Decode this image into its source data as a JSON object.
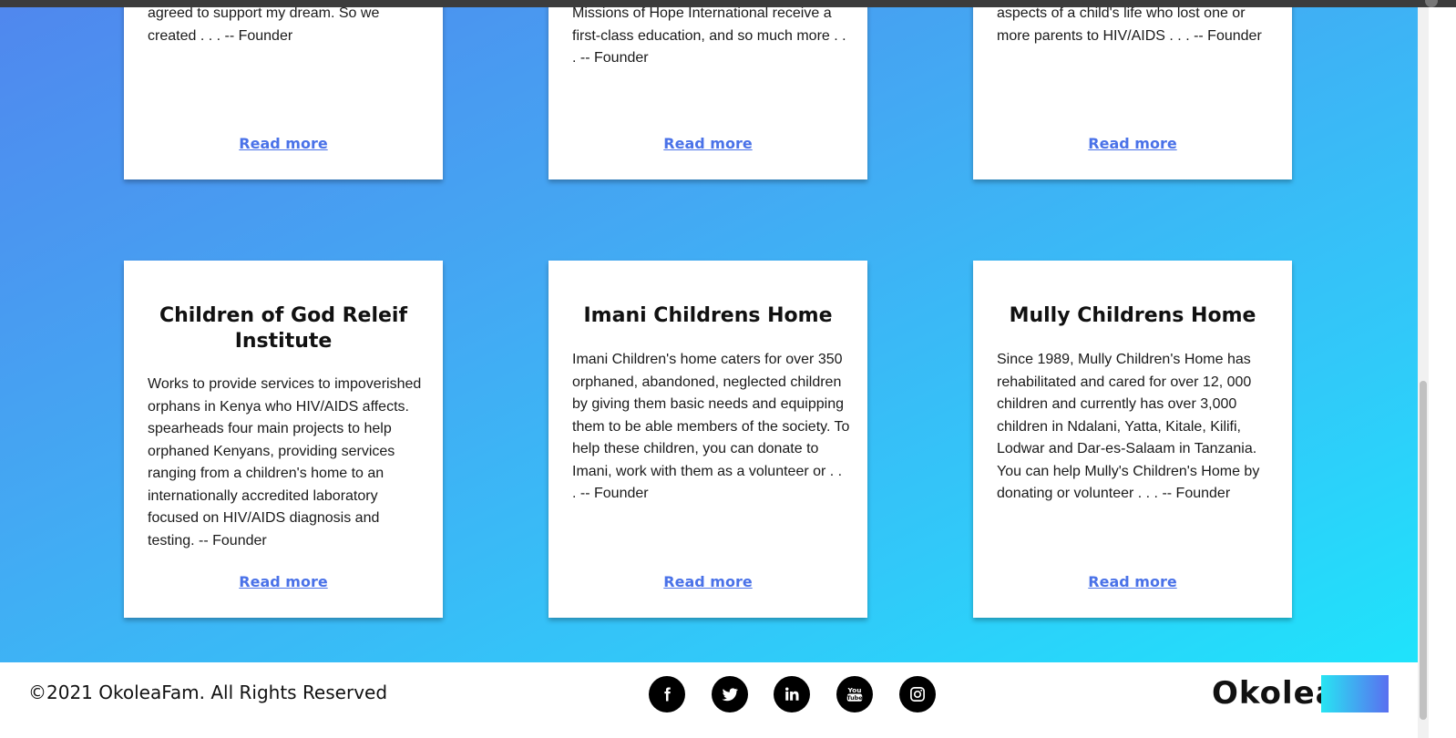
{
  "cards_top": [
    {
      "text_lines": [
        "agreed to support my dream. So we",
        "created . . . -- Founder"
      ],
      "link": "Read more"
    },
    {
      "text_lines": [
        "Missions of Hope International receive a",
        "first-class education, and so much more . .",
        ". -- Founder"
      ],
      "link": "Read more"
    },
    {
      "text_lines": [
        "aspects of a child's life who lost one or",
        "more parents to HIV/AIDS . . . -- Founder"
      ],
      "link": "Read more"
    }
  ],
  "cards_bottom": [
    {
      "title_lines": [
        "Children of God Releif",
        "Institute"
      ],
      "text_lines": [
        "Works to provide services to impoverished",
        "orphans in Kenya who HIV/AIDS affects.",
        "spearheads four main projects to help",
        "orphaned Kenyans, providing services",
        "ranging from a children's home to an",
        "internationally accredited laboratory",
        "focused on HIV/AIDS diagnosis and",
        "testing. -- Founder"
      ],
      "link": "Read more"
    },
    {
      "title_lines": [
        "Imani Childrens Home"
      ],
      "text_lines": [
        "Imani Children's home caters for over 350",
        "orphaned, abandoned, neglected children",
        "by giving them basic needs and equipping",
        "them to be able members of the society. To",
        "help these children, you can donate to",
        "Imani, work with them as a volunteer or . .",
        ". -- Founder"
      ],
      "link": "Read more"
    },
    {
      "title_lines": [
        "Mully Childrens Home"
      ],
      "text_lines": [
        "Since 1989, Mully Children's Home has",
        "rehabilitated and cared for over 12, 000",
        "children and currently has over 3,000",
        "children in Ndalani, Yatta, Kitale, Kilifi,",
        "Lodwar and Dar-es-Salaam in Tanzania.",
        "You can help Mully's Children's Home by",
        "donating or volunteer . . . -- Founder"
      ],
      "link": "Read more"
    }
  ],
  "footer": {
    "copyright": "©2021 OkoleaFam. All Rights Reserved",
    "brand": "Okolea",
    "socials": [
      "facebook-icon",
      "twitter-icon",
      "linkedin-icon",
      "youtube-icon",
      "instagram-icon"
    ]
  },
  "colors": {
    "gradient_start": "#5087ee",
    "gradient_end": "#1fe3fb",
    "link": "#4a72e8",
    "brand_block_start": "#28e4f2",
    "brand_block_end": "#5a6ff0"
  }
}
